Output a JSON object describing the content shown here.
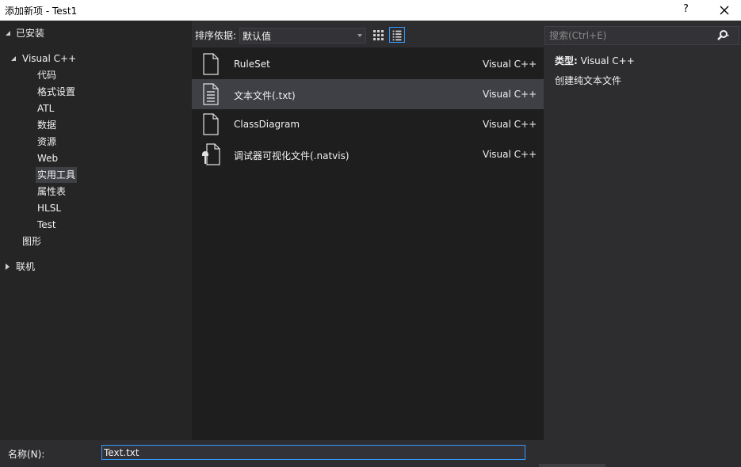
{
  "window": {
    "title": "添加新项 - Test1",
    "help_label": "?",
    "close_label": "close"
  },
  "tree": {
    "installed_label": "已安装",
    "visual_cpp_label": "Visual C++",
    "children": [
      "代码",
      "格式设置",
      "ATL",
      "数据",
      "资源",
      "Web",
      "实用工具",
      "属性表",
      "HLSL",
      "Test"
    ],
    "selected_child": "实用工具",
    "graphics_label": "图形",
    "online_label": "联机"
  },
  "toolbar": {
    "sort_label": "排序依据:",
    "sort_value": "默认值",
    "views": [
      "grid-view-icon",
      "list-view-icon"
    ],
    "active_view": "list-view-icon"
  },
  "search": {
    "placeholder": "搜索(Ctrl+E)"
  },
  "templates": [
    {
      "name": "RuleSet",
      "category": "Visual C++",
      "icon": "blank-file-icon"
    },
    {
      "name": "文本文件(.txt)",
      "category": "Visual C++",
      "icon": "text-file-icon",
      "selected": true
    },
    {
      "name": "ClassDiagram",
      "category": "Visual C++",
      "icon": "blank-file-icon"
    },
    {
      "name": "调试器可视化文件(.natvis)",
      "category": "Visual C++",
      "icon": "natvis-file-icon"
    }
  ],
  "details": {
    "type_label": "类型:",
    "type_value": "Visual C++",
    "description": "创建纯文本文件"
  },
  "name_field": {
    "label": "名称(N):",
    "value": "Text.txt"
  },
  "colors": {
    "background": "#2d2d30",
    "panel": "#252526",
    "list": "#1e1e1e",
    "selection": "#3f3f46",
    "accent": "#3399ff"
  }
}
